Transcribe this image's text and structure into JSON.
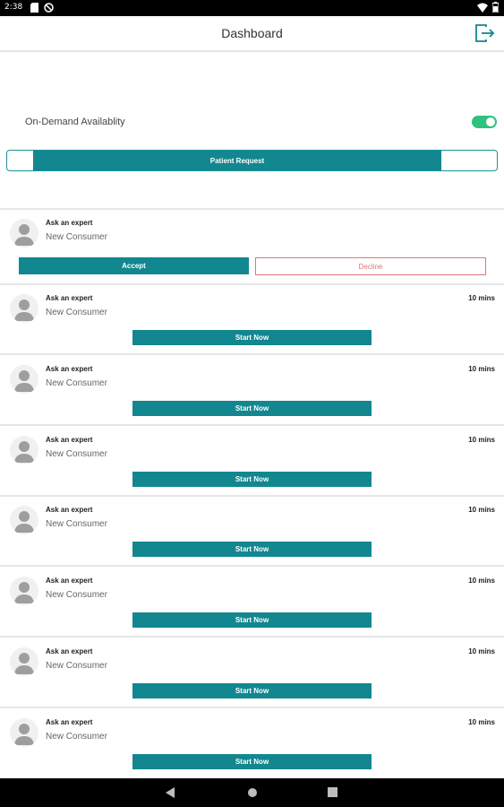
{
  "status_bar": {
    "time": "2:38",
    "icons": [
      "sd-card-icon",
      "no-entry-icon",
      "wifi-icon",
      "battery-icon"
    ]
  },
  "app_bar": {
    "title": "Dashboard",
    "logout_icon": "logout-icon"
  },
  "availability": {
    "label": "On-Demand Availablity",
    "enabled": true,
    "toggle_color": "#2ec27e"
  },
  "segment": {
    "active_label": "Patient Request",
    "accent": "#12878f"
  },
  "request": {
    "category": "Ask an expert",
    "name": "New Consumer",
    "accept_label": "Accept",
    "decline_label": "Decline",
    "decline_color": "#e57373"
  },
  "sessions": [
    {
      "category": "Ask an expert",
      "name": "New Consumer",
      "time": "10 mins",
      "action": "Start Now"
    },
    {
      "category": "Ask an expert",
      "name": "New Consumer",
      "time": "10 mins",
      "action": "Start Now"
    },
    {
      "category": "Ask an expert",
      "name": "New Consumer",
      "time": "10 mins",
      "action": "Start Now"
    },
    {
      "category": "Ask an expert",
      "name": "New Consumer",
      "time": "10 mins",
      "action": "Start Now"
    },
    {
      "category": "Ask an expert",
      "name": "New Consumer",
      "time": "10 mins",
      "action": "Start Now"
    },
    {
      "category": "Ask an expert",
      "name": "New Consumer",
      "time": "10 mins",
      "action": "Start Now"
    },
    {
      "category": "Ask an expert",
      "name": "New Consumer",
      "time": "10 mins",
      "action": "Start Now"
    }
  ],
  "nav_bar": {
    "icons": [
      "back-icon",
      "home-icon",
      "recents-icon"
    ]
  }
}
